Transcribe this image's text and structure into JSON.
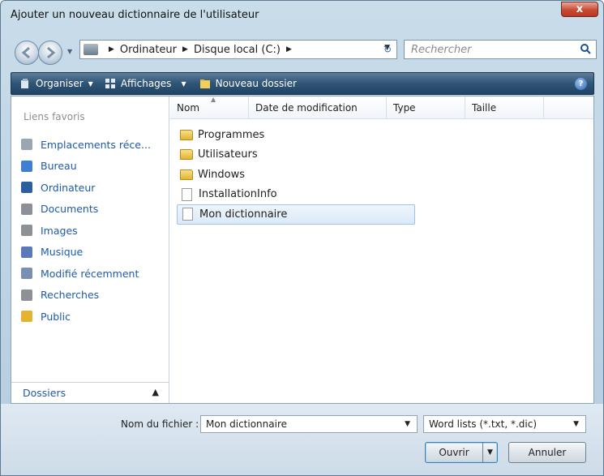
{
  "window": {
    "title": "Ajouter un nouveau dictionnaire de l'utilisateur",
    "close_glyph": "x"
  },
  "address": {
    "crumbs": [
      "Ordinateur",
      "Disque local (C:)"
    ],
    "search_placeholder": "Rechercher"
  },
  "toolbar": {
    "organize": "Organiser",
    "views": "Affichages",
    "new_folder": "Nouveau dossier",
    "help": "?"
  },
  "sidebar": {
    "title": "Liens favoris",
    "items": [
      {
        "label": "Emplacements réce...",
        "icon": "recent-places-icon",
        "color": "#9aa6b2"
      },
      {
        "label": "Bureau",
        "icon": "desktop-icon",
        "color": "#3f7fd0"
      },
      {
        "label": "Ordinateur",
        "icon": "computer-icon",
        "color": "#2c5fa0"
      },
      {
        "label": "Documents",
        "icon": "documents-icon",
        "color": "#8c9097"
      },
      {
        "label": "Images",
        "icon": "pictures-icon",
        "color": "#8c9097"
      },
      {
        "label": "Musique",
        "icon": "music-icon",
        "color": "#5b79b8"
      },
      {
        "label": "Modifié récemment",
        "icon": "recently-changed-icon",
        "color": "#7a8fb3"
      },
      {
        "label": "Recherches",
        "icon": "searches-icon",
        "color": "#8c9097"
      },
      {
        "label": "Public",
        "icon": "public-folder-icon",
        "color": "#e4b331"
      }
    ],
    "folders_label": "Dossiers"
  },
  "columns": [
    "Nom",
    "Date de modification",
    "Type",
    "Taille"
  ],
  "files": [
    {
      "name": "Programmes",
      "kind": "folder"
    },
    {
      "name": "Utilisateurs",
      "kind": "folder"
    },
    {
      "name": "Windows",
      "kind": "folder"
    },
    {
      "name": "InstallationInfo",
      "kind": "file"
    },
    {
      "name": "Mon dictionnaire",
      "kind": "file",
      "selected": true
    }
  ],
  "footer": {
    "filename_label": "Nom du fichier :",
    "filename_value": "Mon dictionnaire",
    "filetype_value": "Word lists (*.txt, *.dic)",
    "open_label": "Ouvrir",
    "cancel_label": "Annuler"
  }
}
